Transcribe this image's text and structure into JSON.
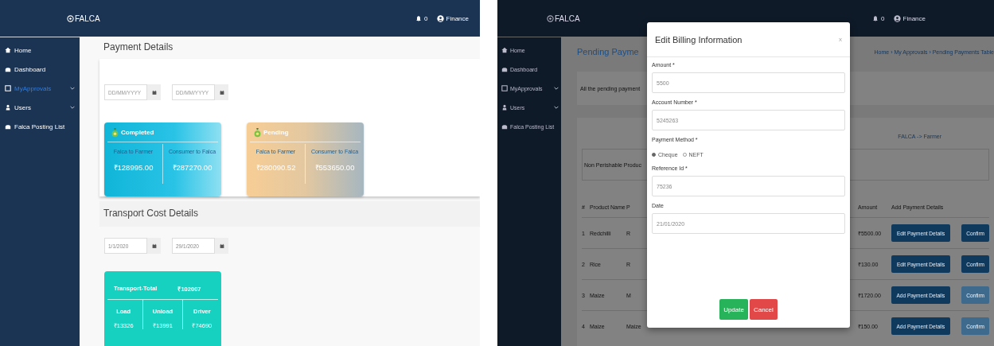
{
  "left_screen": {
    "header": {
      "logo": "FALCA",
      "notifications": "0",
      "user": "Finance"
    },
    "sidebar": {
      "items": [
        {
          "label": "Home",
          "selected": false,
          "expandable": false
        },
        {
          "label": "Dashboard",
          "selected": false,
          "expandable": false
        },
        {
          "label": "MyApprovals",
          "selected": true,
          "expandable": true
        },
        {
          "label": "Users",
          "selected": false,
          "expandable": true
        },
        {
          "label": "Falca Posting List",
          "selected": false,
          "expandable": false
        }
      ]
    },
    "payment_details": {
      "title": "Payment Details",
      "date_fields": [
        {
          "placeholder": "DD/MM/YYYY"
        },
        {
          "placeholder": "DD/MM/YYYY"
        }
      ],
      "cards": [
        {
          "kind": "completed",
          "title": "Completed",
          "columns": [
            {
              "label": "Falca to Farmer",
              "amount": "₹128995.00"
            },
            {
              "label": "Consumer to Falca",
              "amount": "₹287270.00"
            }
          ]
        },
        {
          "kind": "pending",
          "title": "Pending",
          "columns": [
            {
              "label": "Falca to Farmer",
              "amount": "₹280090.52"
            },
            {
              "label": "Consumer to Falca",
              "amount": "₹553650.00"
            }
          ]
        }
      ]
    },
    "transport": {
      "title": "Transport Cost Details",
      "date_fields": [
        {
          "value": "1/1/2020"
        },
        {
          "value": "29/1/2020"
        }
      ],
      "card": {
        "total_label": "Transport-Total",
        "total": "₹102007",
        "columns": [
          {
            "label": "Load",
            "amount": "₹13326"
          },
          {
            "label": "Unload",
            "amount": "₹13991"
          },
          {
            "label": "Driver",
            "amount": "₹74690"
          }
        ]
      }
    }
  },
  "right_screen": {
    "header": {
      "logo": "FALCA",
      "notifications": "0",
      "user": "Finance"
    },
    "sidebar": {
      "items": [
        {
          "label": "Home",
          "selected": false,
          "expandable": false
        },
        {
          "label": "Dashboard",
          "selected": false,
          "expandable": false
        },
        {
          "label": "MyApprovals",
          "selected": false,
          "expandable": true
        },
        {
          "label": "Users",
          "selected": false,
          "expandable": true
        },
        {
          "label": "Falca Posting List",
          "selected": false,
          "expandable": false
        }
      ]
    },
    "page_title": "Pending Payme",
    "breadcrumb": "Home › My Approvals › Pending Payments Table",
    "description": "All the pending payment",
    "tab": "FALCA -> Farmer",
    "section": "Non Perishable Produc",
    "table": {
      "columns": [
        "#",
        "Product Name",
        "P",
        "Amount",
        "Add Payment Details"
      ],
      "rows": [
        {
          "number": "1",
          "product": "Redchilli",
          "column_3": "R",
          "amount": "₹5500.00",
          "action": "Edit Payment Details",
          "confirm": "Confirm",
          "confirm_disabled": false
        },
        {
          "number": "2",
          "product": "Rice",
          "column_3": "R",
          "amount": "₹130.00",
          "action": "Edit Payment Details",
          "confirm": "Confirm",
          "confirm_disabled": false
        },
        {
          "number": "3",
          "product": "Maize",
          "column_3": "M",
          "amount": "₹1720.00",
          "action": "Add Payment Details",
          "confirm": "Confirm",
          "confirm_disabled": true
        },
        {
          "number": "4",
          "product": "Maize",
          "column_3": "Maize",
          "amount": "₹150.00",
          "action": "Add Payment Details",
          "confirm": "Confirm",
          "confirm_disabled": true
        }
      ]
    },
    "modal": {
      "title": "Edit Billing Information",
      "close": "x",
      "fields": [
        {
          "kind": "text",
          "label": "Amount *",
          "value": "5500"
        },
        {
          "kind": "text",
          "label": "Account Number *",
          "value": "5245263"
        },
        {
          "kind": "radio",
          "label": "Payment Method *",
          "options": [
            {
              "label": "Cheque",
              "selected": true
            },
            {
              "label": "NEFT",
              "selected": false
            }
          ]
        },
        {
          "kind": "text",
          "label": "Reference Id *",
          "value": "75236"
        },
        {
          "kind": "text",
          "label": "Date",
          "value": "21/01/2020"
        }
      ],
      "buttons": [
        {
          "kind": "update",
          "label": "Update"
        },
        {
          "kind": "cancel",
          "label": "Cancel"
        }
      ]
    }
  }
}
